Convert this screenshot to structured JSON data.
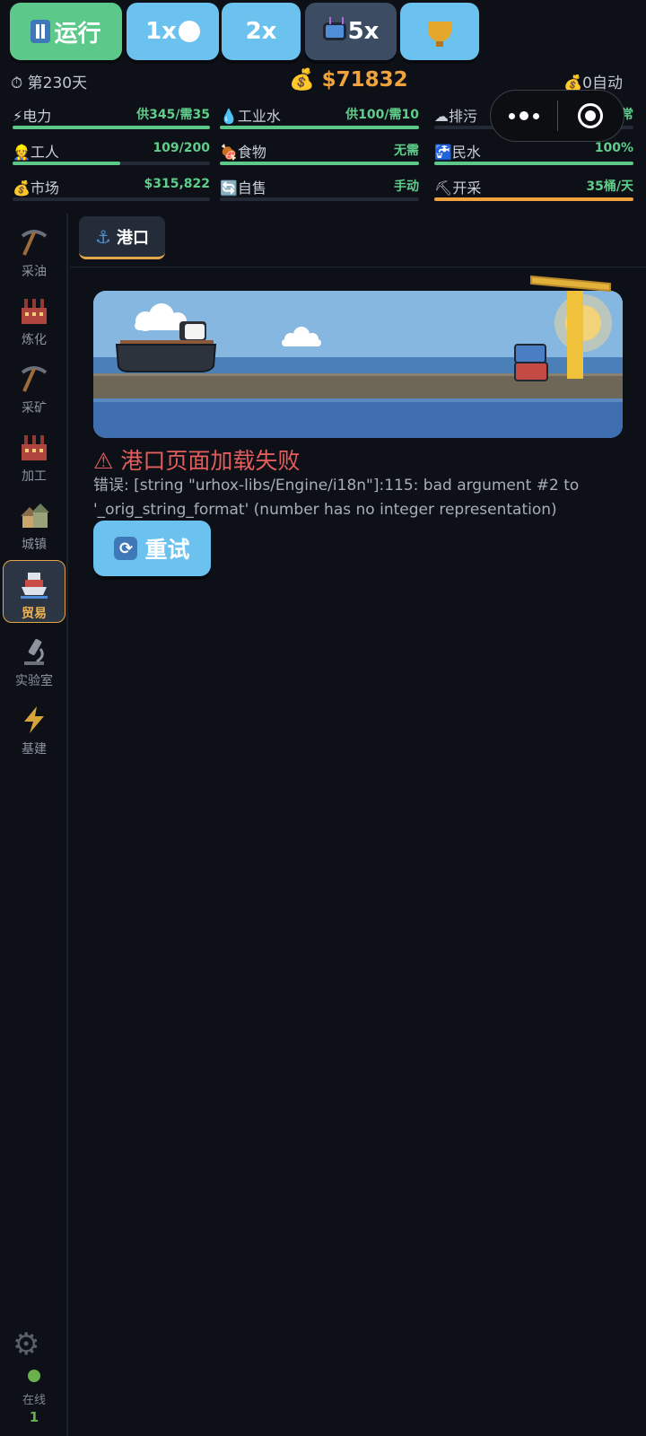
{
  "topbar": {
    "run_label": "运行",
    "speed1_label": "1x",
    "speed2_label": "2x",
    "speed5_label": "5x"
  },
  "status": {
    "day": "⏱ 第230天",
    "money": "💰 $71832",
    "auto": "💰0自动"
  },
  "resources": [
    {
      "label": "⚡电力",
      "value": "供345/需35",
      "fill": 1.0,
      "color": "#5cc98a"
    },
    {
      "label": "💧工业水",
      "value": "供100/需10",
      "fill": 1.0,
      "color": "#5cc98a"
    },
    {
      "label": "☁排污",
      "value": "正常",
      "fill": 0.0,
      "color": "#5cc98a"
    },
    {
      "label": "👷工人",
      "value": "109/200",
      "fill": 0.545,
      "color": "#5cc98a"
    },
    {
      "label": "🍖食物",
      "value": "无需",
      "fill": 1.0,
      "color": "#5cc98a"
    },
    {
      "label": "🚰民水",
      "value": "100%",
      "fill": 1.0,
      "color": "#5cc98a"
    },
    {
      "label": "💰市场",
      "value": "$315,822",
      "fill": 0.0,
      "color": "#5cc98a"
    },
    {
      "label": "🔄自售",
      "value": "手动",
      "fill": 0.0,
      "color": "#5cc98a"
    },
    {
      "label": "⛏开采",
      "value": "35桶/天",
      "fill": 1.0,
      "color": "#f0a33c"
    }
  ],
  "sidebar": {
    "items": [
      {
        "label": "采油",
        "icon": "pickaxe-icon"
      },
      {
        "label": "炼化",
        "icon": "factory-icon"
      },
      {
        "label": "采矿",
        "icon": "pickaxe-icon"
      },
      {
        "label": "加工",
        "icon": "factory-icon"
      },
      {
        "label": "城镇",
        "icon": "houses-icon"
      },
      {
        "label": "贸易",
        "icon": "ship-icon"
      },
      {
        "label": "实验室",
        "icon": "microscope-icon"
      },
      {
        "label": "基建",
        "icon": "lightning-icon"
      }
    ],
    "active_index": 5,
    "online_label": "在线",
    "online_count": "1"
  },
  "tab": {
    "label": "港口"
  },
  "error": {
    "title": "⚠ 港口页面加载失败",
    "message": "错误: [string \"urhox-libs/Engine/i18n\"]:115: bad argument #2 to '_orig_string_format' (number has no integer representation)",
    "retry_label": "重试"
  }
}
